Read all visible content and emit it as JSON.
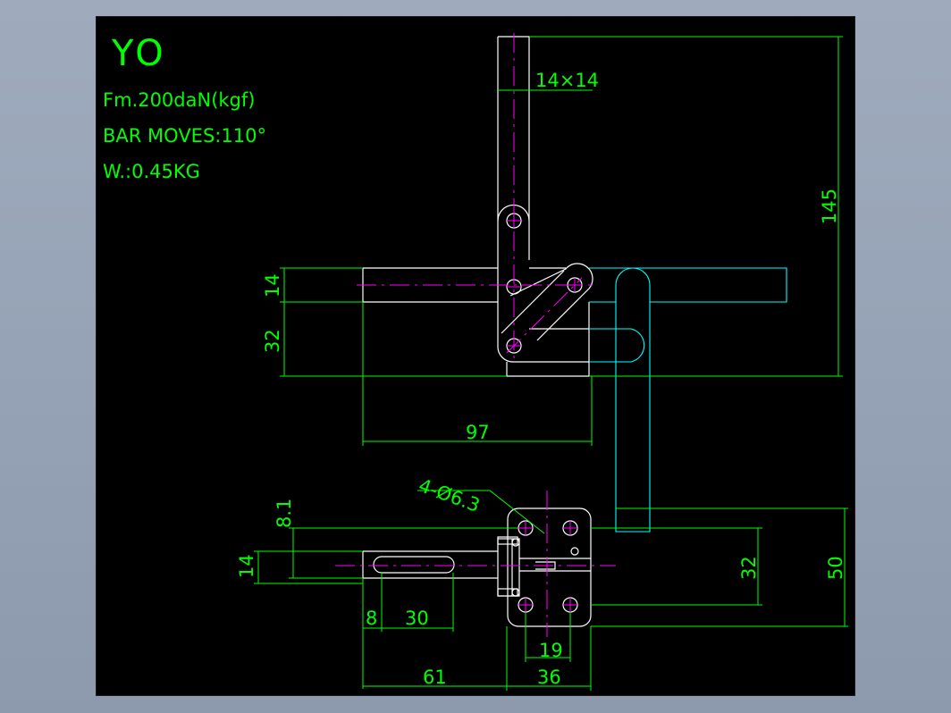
{
  "colors": {
    "background": "#000000",
    "outline": "#ffffff",
    "dimension": "#00ff00",
    "centerline": "#ff00ff",
    "hidden": "#00ffff",
    "title_text": "#00ff00"
  },
  "title_block": {
    "model": "YO",
    "force": "Fm.200daN(kgf)",
    "bar_moves": "BAR MOVES:110°",
    "weight": "W.:0.45KG"
  },
  "dimensions": {
    "bar_section": "14×14",
    "height_total": "145",
    "arm_thickness": "14",
    "arm_offset": "32",
    "arm_length": "97",
    "holes": "4-Ø6.3",
    "base_offset": "8.1",
    "slot_width": "14",
    "slot_start": "8",
    "slot_length": "30",
    "base_to_pivot": "61",
    "base_width": "36",
    "hole_spacing_x": "19",
    "hole_spacing_y": "32",
    "base_height": "50"
  }
}
